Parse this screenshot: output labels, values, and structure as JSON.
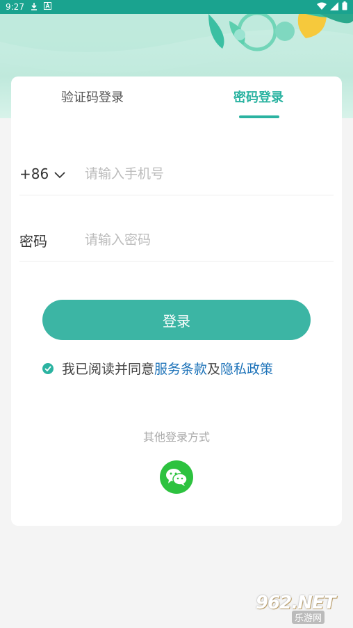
{
  "status_bar": {
    "time": "9:27",
    "icons": [
      "download-icon",
      "a-icon",
      "wifi-icon",
      "signal-icon",
      "battery-icon"
    ]
  },
  "tabs": {
    "sms_label": "验证码登录",
    "password_label": "密码登录",
    "active": "password"
  },
  "phone": {
    "country_code": "+86",
    "placeholder": "请输入手机号"
  },
  "password": {
    "label": "密码",
    "placeholder": "请输入密码"
  },
  "login_button": "登录",
  "agreement": {
    "prefix": "我已阅读并同意",
    "terms": "服务条款",
    "conjunction": "及",
    "privacy": "隐私政策",
    "checked": true
  },
  "other_login": {
    "label": "其他登录方式",
    "methods": [
      "wechat-icon"
    ]
  },
  "watermark": {
    "top": "962.NET",
    "bottom": "乐游网"
  },
  "colors": {
    "accent": "#2bb3a1",
    "button": "#3cb5a4",
    "link": "#1e73b9",
    "wechat": "#2dc23f",
    "status_bar": "#1aa38f"
  }
}
